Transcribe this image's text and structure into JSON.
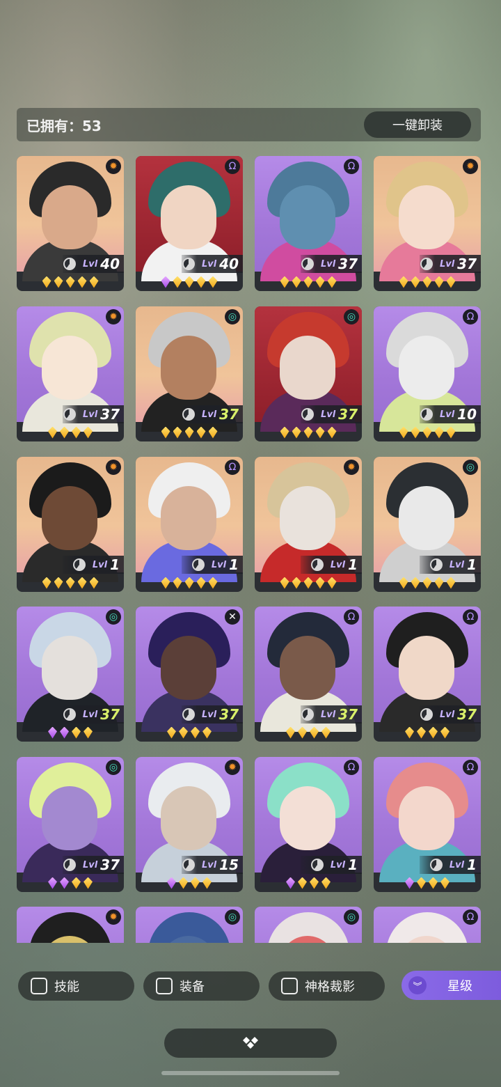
{
  "header": {
    "owned_label": "已拥有：53",
    "unequip_label": "一键卸装"
  },
  "cards": [
    {
      "bg": "orange",
      "faction": "orange",
      "faction_icon": "✹",
      "level_tag": "Lvl",
      "level": "40",
      "green": false,
      "gems": [
        "y",
        "y",
        "y",
        "y",
        "y"
      ],
      "hair": "#2a2a2a",
      "skin": "#d9a98a",
      "cloth": "#3a3a3a"
    },
    {
      "bg": "red",
      "faction": "purple",
      "faction_icon": "Ω",
      "level_tag": "Lvl",
      "level": "40",
      "green": false,
      "gems": [
        "p",
        "y",
        "y",
        "y",
        "y"
      ],
      "hair": "#2e6d6a",
      "skin": "#f0d5c3",
      "cloth": "#f2f2f2"
    },
    {
      "bg": "purple",
      "faction": "purple",
      "faction_icon": "Ω",
      "level_tag": "Lvl",
      "level": "37",
      "green": false,
      "gems": [
        "y",
        "y",
        "y",
        "y",
        "y"
      ],
      "hair": "#4d7a9a",
      "skin": "#5f8fb0",
      "cloth": "#d04ca0"
    },
    {
      "bg": "orange",
      "faction": "orange",
      "faction_icon": "✹",
      "level_tag": "Lvl",
      "level": "37",
      "green": false,
      "gems": [
        "y",
        "y",
        "y",
        "y",
        "y"
      ],
      "hair": "#e0c48a",
      "skin": "#f5dccd",
      "cloth": "#e67a9a"
    },
    {
      "bg": "purple",
      "faction": "orange",
      "faction_icon": "✹",
      "level_tag": "Lvl",
      "level": "37",
      "green": false,
      "gems": [
        "y",
        "y",
        "y",
        "y"
      ],
      "hair": "#dfe2ad",
      "skin": "#f7e6d6",
      "cloth": "#e9e7dc"
    },
    {
      "bg": "orange",
      "faction": "teal",
      "faction_icon": "◎",
      "level_tag": "Lvl",
      "level": "37",
      "green": true,
      "gems": [
        "y",
        "y",
        "y",
        "y",
        "y"
      ],
      "hair": "#c8c8c8",
      "skin": "#b38060",
      "cloth": "#222222"
    },
    {
      "bg": "red",
      "faction": "teal",
      "faction_icon": "◎",
      "level_tag": "Lvl",
      "level": "37",
      "green": true,
      "gems": [
        "y",
        "y",
        "y",
        "y",
        "y"
      ],
      "hair": "#c63a2e",
      "skin": "#e9d7cc",
      "cloth": "#5a2a5a"
    },
    {
      "bg": "purple",
      "faction": "purple",
      "faction_icon": "Ω",
      "level_tag": "Lvl",
      "level": "10",
      "green": false,
      "gems": [
        "y",
        "y",
        "y",
        "y",
        "y"
      ],
      "hair": "#dadada",
      "skin": "#ececec",
      "cloth": "#d7e69a"
    },
    {
      "bg": "orange",
      "faction": "orange",
      "faction_icon": "✹",
      "level_tag": "Lvl",
      "level": "1",
      "green": false,
      "gems": [
        "y",
        "y",
        "y",
        "y",
        "y"
      ],
      "hair": "#1b1b1b",
      "skin": "#6e4a36",
      "cloth": "#2a2a2a"
    },
    {
      "bg": "orange",
      "faction": "purple",
      "faction_icon": "Ω",
      "level_tag": "Lvl",
      "level": "1",
      "green": false,
      "gems": [
        "y",
        "y",
        "y",
        "y",
        "y"
      ],
      "hair": "#efefef",
      "skin": "#d8b29a",
      "cloth": "#6a6ae0"
    },
    {
      "bg": "orange",
      "faction": "orange",
      "faction_icon": "✹",
      "level_tag": "Lvl",
      "level": "1",
      "green": false,
      "gems": [
        "y",
        "y",
        "y",
        "y",
        "y"
      ],
      "hair": "#d7c49a",
      "skin": "#e9e2dc",
      "cloth": "#c62a2a"
    },
    {
      "bg": "orange",
      "faction": "teal",
      "faction_icon": "◎",
      "level_tag": "Lvl",
      "level": "1",
      "green": false,
      "gems": [
        "y",
        "y",
        "y",
        "y",
        "y"
      ],
      "hair": "#2b2f33",
      "skin": "#e9e9e9",
      "cloth": "#cfcfcf"
    },
    {
      "bg": "purple",
      "faction": "teal",
      "faction_icon": "◎",
      "level_tag": "Lvl",
      "level": "37",
      "green": true,
      "gems": [
        "p",
        "p",
        "y",
        "y"
      ],
      "hair": "#c9d7e6",
      "skin": "#e4e0dc",
      "cloth": "#1f2328"
    },
    {
      "bg": "purple",
      "faction": "white",
      "faction_icon": "✕",
      "level_tag": "Lvl",
      "level": "37",
      "green": true,
      "gems": [
        "y",
        "y",
        "y",
        "y"
      ],
      "hair": "#2a1f5a",
      "skin": "#5b3f38",
      "cloth": "#3a3260"
    },
    {
      "bg": "purple",
      "faction": "purple",
      "faction_icon": "Ω",
      "level_tag": "Lvl",
      "level": "37",
      "green": true,
      "gems": [
        "y",
        "y",
        "y",
        "y"
      ],
      "hair": "#232a3a",
      "skin": "#7a5a4a",
      "cloth": "#e9e7dc"
    },
    {
      "bg": "purple",
      "faction": "purple",
      "faction_icon": "Ω",
      "level_tag": "Lvl",
      "level": "37",
      "green": true,
      "gems": [
        "y",
        "y",
        "y",
        "y"
      ],
      "hair": "#1f1f1f",
      "skin": "#f0d8c8",
      "cloth": "#2a2a2a"
    },
    {
      "bg": "purple",
      "faction": "teal",
      "faction_icon": "◎",
      "level_tag": "Lvl",
      "level": "37",
      "green": false,
      "gems": [
        "p",
        "p",
        "y",
        "y"
      ],
      "hair": "#e0ef9a",
      "skin": "#a389d0",
      "cloth": "#3a2a5a"
    },
    {
      "bg": "purple",
      "faction": "orange",
      "faction_icon": "✹",
      "level_tag": "Lvl",
      "level": "15",
      "green": false,
      "gems": [
        "p",
        "y",
        "y",
        "y"
      ],
      "hair": "#e9ecef",
      "skin": "#d8c6b6",
      "cloth": "#c6d0da"
    },
    {
      "bg": "purple",
      "faction": "purple",
      "faction_icon": "Ω",
      "level_tag": "Lvl",
      "level": "1",
      "green": false,
      "gems": [
        "p",
        "y",
        "y",
        "y"
      ],
      "hair": "#8be0c8",
      "skin": "#f3dfd6",
      "cloth": "#2a1f3a"
    },
    {
      "bg": "purple",
      "faction": "purple",
      "faction_icon": "Ω",
      "level_tag": "Lvl",
      "level": "1",
      "green": false,
      "gems": [
        "p",
        "y",
        "y",
        "y"
      ],
      "hair": "#e68c8c",
      "skin": "#f3d7cc",
      "cloth": "#5ab0c0"
    },
    {
      "bg": "purple",
      "faction": "orange",
      "faction_icon": "✹",
      "level_tag": "",
      "level": "",
      "green": false,
      "gems": [],
      "hair": "#1f1f1f",
      "skin": "#d9c06a",
      "cloth": "#3a3a3a"
    },
    {
      "bg": "purple",
      "faction": "teal",
      "faction_icon": "◎",
      "level_tag": "",
      "level": "",
      "green": false,
      "gems": [],
      "hair": "#3a5a9a",
      "skin": "#4a6aa0",
      "cloth": "#2a2a2a"
    },
    {
      "bg": "purple",
      "faction": "teal",
      "faction_icon": "◎",
      "level_tag": "",
      "level": "",
      "green": false,
      "gems": [],
      "hair": "#e9e2e2",
      "skin": "#e06a6a",
      "cloth": "#e9e9e9"
    },
    {
      "bg": "purple",
      "faction": "purple",
      "faction_icon": "Ω",
      "level_tag": "",
      "level": "",
      "green": false,
      "gems": [],
      "hair": "#f0e9e9",
      "skin": "#f0d6cc",
      "cloth": "#d0d0d0"
    }
  ],
  "filters": {
    "skill_label": "技能",
    "equip_label": "装备",
    "divine_label": "神格裁影",
    "star_label": "星级",
    "star_icon": "double-chevron-down-icon"
  },
  "bottom": {
    "icon": "diamond-cluster-icon"
  }
}
